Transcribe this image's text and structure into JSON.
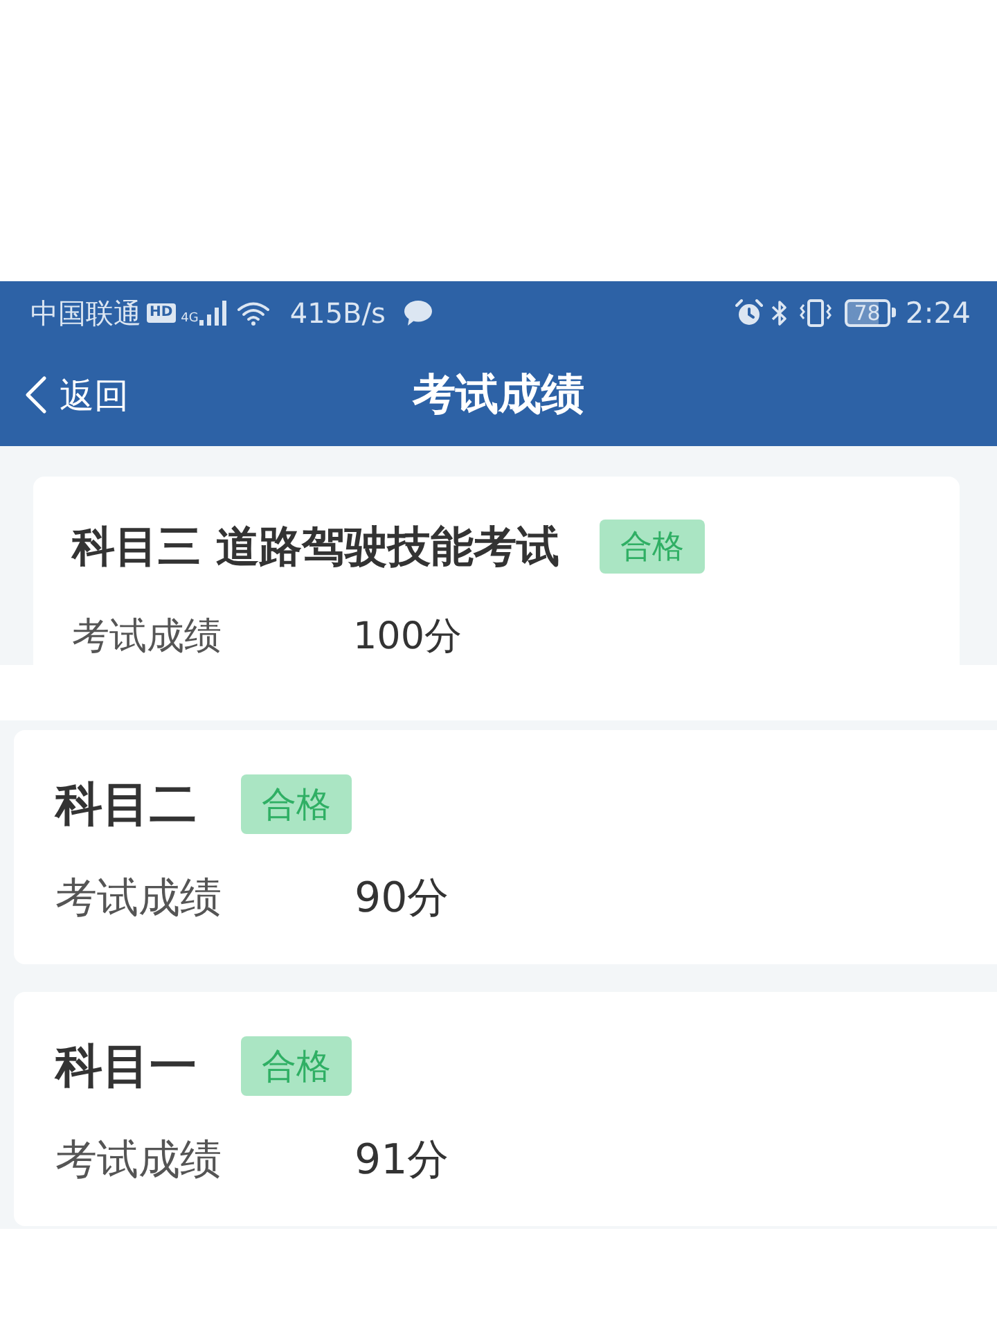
{
  "top_screen": {
    "status_bar": {
      "carrier": "中国联通",
      "hd_badge": "HD",
      "network_type": "4G",
      "speed": "415B/s",
      "battery": "78",
      "time": "2:24"
    },
    "nav_bar": {
      "back_label": "返回",
      "title": "考试成绩"
    },
    "result_cards": [
      {
        "subject": "科目三 道路驾驶技能考试",
        "status": "合格",
        "rows": [
          {
            "label": "考试成绩",
            "value": "100分"
          }
        ]
      }
    ]
  },
  "bottom_screen": {
    "result_cards": [
      {
        "subject": "科目二",
        "status": "合格",
        "rows": [
          {
            "label": "考试成绩",
            "value": "90分"
          }
        ]
      },
      {
        "subject": "科目一",
        "status": "合格",
        "rows": [
          {
            "label": "考试成绩",
            "value": "91分"
          }
        ]
      }
    ]
  }
}
